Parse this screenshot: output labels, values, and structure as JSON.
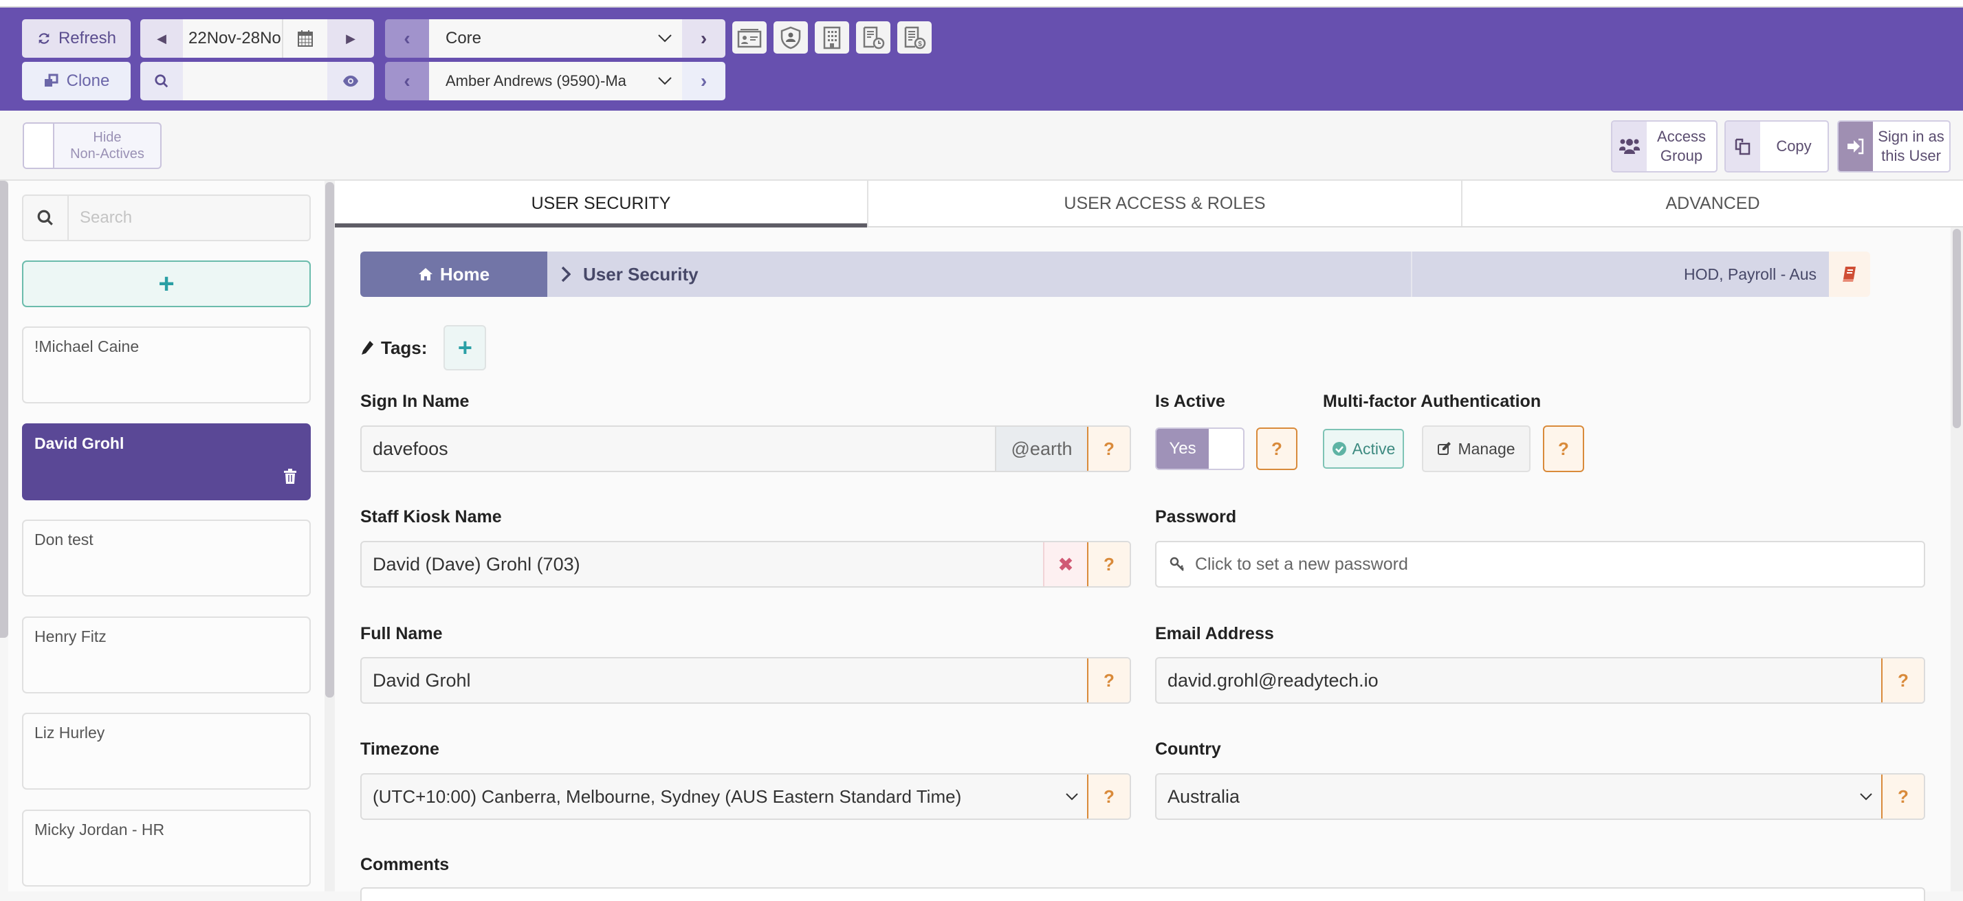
{
  "header": {
    "refresh_label": "Refresh",
    "clone_label": "Clone",
    "date_range": "22Nov-28No",
    "search_value": "",
    "module_select": "Core",
    "user_select": "Amber Andrews (9590)-Ma",
    "toolbar_icons": [
      "id-card-icon",
      "user-shield-icon",
      "building-icon",
      "document-clock-icon",
      "document-dollar-icon"
    ]
  },
  "subbar": {
    "hide_nonactives_label_1": "Hide",
    "hide_nonactives_label_2": "Non-Actives",
    "access_group_1": "Access",
    "access_group_2": "Group",
    "copy_label": "Copy",
    "signin_1": "Sign in as",
    "signin_2": "this User"
  },
  "sidebar": {
    "search_placeholder": "Search",
    "add_label": "+",
    "users": [
      {
        "name": "!Michael Caine",
        "selected": false
      },
      {
        "name": "David Grohl",
        "selected": true
      },
      {
        "name": "Don test",
        "selected": false
      },
      {
        "name": "Henry Fitz",
        "selected": false
      },
      {
        "name": "Liz Hurley",
        "selected": false
      },
      {
        "name": "Micky Jordan - HR",
        "selected": false
      }
    ]
  },
  "tabs": [
    {
      "label": "USER SECURITY",
      "active": true
    },
    {
      "label": "USER ACCESS & ROLES",
      "active": false
    },
    {
      "label": "ADVANCED",
      "active": false
    }
  ],
  "breadcrumb": {
    "home": "Home",
    "current": "User Security",
    "context": "HOD, Payroll - Aus"
  },
  "form": {
    "tags_label": "Tags:",
    "sign_in_name": {
      "label": "Sign In Name",
      "value": "davefoos",
      "suffix": "@earth"
    },
    "is_active": {
      "label": "Is Active",
      "value": "Yes"
    },
    "mfa": {
      "label": "Multi-factor Authentication",
      "status": "Active",
      "manage_label": "Manage"
    },
    "staff_kiosk_name": {
      "label": "Staff Kiosk Name",
      "value": "David (Dave) Grohl (703)"
    },
    "password": {
      "label": "Password",
      "placeholder": "Click to set a new password"
    },
    "full_name": {
      "label": "Full Name",
      "value": "David Grohl"
    },
    "email": {
      "label": "Email Address",
      "value": "david.grohl@readytech.io"
    },
    "timezone": {
      "label": "Timezone",
      "value": "(UTC+10:00) Canberra, Melbourne, Sydney (AUS Eastern Standard Time)"
    },
    "country": {
      "label": "Country",
      "value": "Australia"
    },
    "comments": {
      "label": "Comments"
    },
    "help_glyph": "?"
  },
  "colors": {
    "header_bg": "#6750af",
    "selected_user_bg": "#5a4896",
    "help_accent": "#d98a3a",
    "add_accent": "#2a9fa4"
  }
}
